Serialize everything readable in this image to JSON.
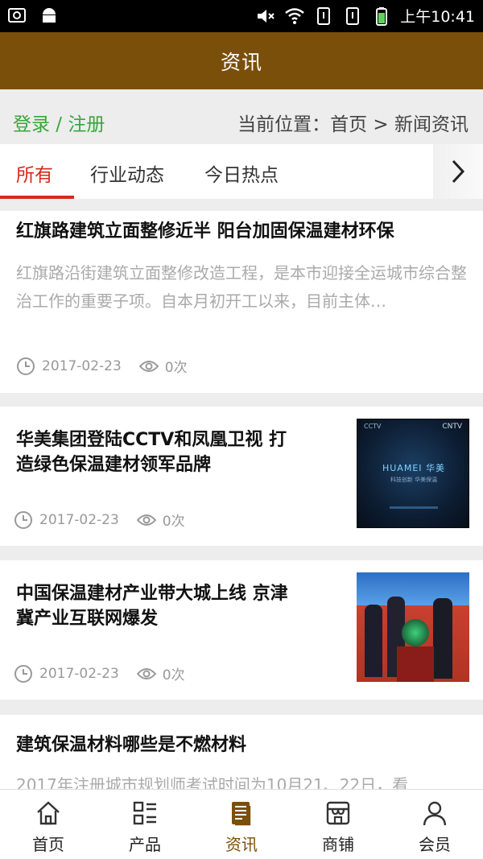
{
  "status_bar": {
    "time": "上午10:41"
  },
  "header": {
    "title": "资讯"
  },
  "breadcrumb": {
    "login": "登录 / 注册",
    "location": "当前位置：首页 > 新闻资讯"
  },
  "tabs": [
    {
      "label": "所有",
      "active": true
    },
    {
      "label": "行业动态",
      "active": false
    },
    {
      "label": "今日热点",
      "active": false
    }
  ],
  "articles": [
    {
      "title": "红旗路建筑立面整修近半 阳台加固保温建材环保",
      "summary": "红旗路沿街建筑立面整修改造工程，是本市迎接全运城市综合整治工作的重要子项。自本月初开工以来，目前主体…",
      "date": "2017-02-23",
      "views": "0次"
    },
    {
      "title_line1": "华美集团登陆CCTV和凤凰卫视 打",
      "title_line2": "造绿色保温建材领军品牌",
      "date": "2017-02-23",
      "views": "0次",
      "thumb_text": "HUAMEI 华美",
      "thumb_sub": "科技创新 华美保温",
      "thumb_logo": "CNTV"
    },
    {
      "title_line1": "中国保温建材产业带大城上线 京津",
      "title_line2": "冀产业互联网爆发",
      "date": "2017-02-23",
      "views": "0次"
    },
    {
      "title": "建筑保温材料哪些是不燃材料",
      "summary": "2017年注册城市规划师考试时间为10月21、22日，看"
    }
  ],
  "bottom_nav": [
    {
      "label": "首页",
      "icon": "home-icon"
    },
    {
      "label": "产品",
      "icon": "grid-list-icon"
    },
    {
      "label": "资讯",
      "icon": "document-icon",
      "active": true
    },
    {
      "label": "商铺",
      "icon": "store-icon"
    },
    {
      "label": "会员",
      "icon": "user-icon"
    }
  ],
  "colors": {
    "brand": "#7a4f0a",
    "accent_red": "#d9281c",
    "login_green": "#3aa53a"
  }
}
